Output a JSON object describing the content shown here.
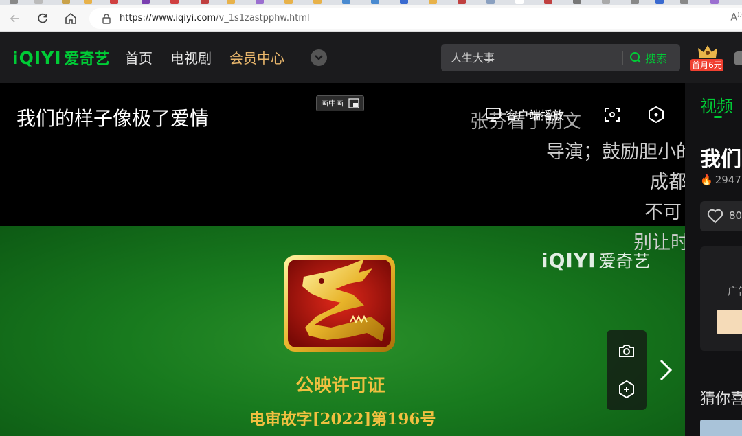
{
  "browser": {
    "url_host": "https://www.iqiyi.com",
    "url_path": "/v_1s1zastpphw.html",
    "reader_label": "A"
  },
  "header": {
    "logo_en": "iQIYI",
    "logo_cn": "爱奇艺",
    "nav": [
      {
        "label": "首页",
        "active": false
      },
      {
        "label": "电视剧",
        "active": false
      },
      {
        "label": "会员中心",
        "active": true
      }
    ],
    "search_placeholder": "人生大事",
    "search_button": "搜索",
    "vip_tag": "首月6元"
  },
  "player": {
    "title": "我们的样子像极了爱情",
    "pip_label": "画中画",
    "client_play_label": "客户端播放",
    "danmu": [
      "张芬看了朔文",
      "导演；鼓励胆小的",
      "成都",
      "不可",
      "别让时"
    ],
    "watermark_en": "iQIYI",
    "watermark_cn": "爱奇艺",
    "license_title": "公映许可证",
    "license_number": "电审故字[2022]第196号",
    "colors": {
      "band": "#187a1e",
      "gold": "#f0c040",
      "brand": "#00cc36"
    }
  },
  "panel": {
    "tab_label": "视频",
    "title": "我们",
    "heat": "2947",
    "likes": "80",
    "ad_label": "广告",
    "guess_label": "猜你喜"
  }
}
